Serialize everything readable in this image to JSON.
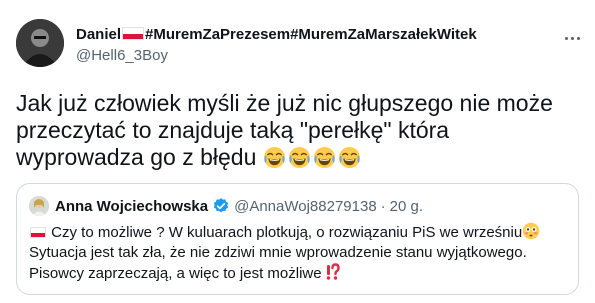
{
  "author": {
    "name_before_flag": "Daniel",
    "name_after_flag": "#MuremZaPrezesem#MuremZaMarszałekWitek",
    "handle": "@Hell6_3Boy",
    "flag_icon": "poland-flag-icon"
  },
  "tweet": {
    "text": "Jak już człowiek myśli że już nic głupszego nie może przeczytać to znajduje taką \"perełkę\" która wyprowadza go z błędu",
    "emoji": "face-with-tears-of-joy-icon",
    "emoji_count": 4
  },
  "quoted": {
    "name": "Anna Wojciechowska",
    "handle": "@AnnaWoj88279138",
    "separator": "·",
    "time": "20 g.",
    "line1": " Czy to możliwe ?  W kuluarach plotkują, o rozwiązaniu PiS  we wrześniu",
    "line2": "Sytuacja jest tak zła, że nie zdziwi mnie wprowadzenie stanu wyjątkowego.",
    "line3": "Pisowcy zaprzeczają, a więc to jest możliwe ",
    "icons": [
      "poland-flag-icon",
      "verified-badge-icon",
      "flushed-face-icon",
      "exclamation-question-icon"
    ]
  },
  "colors": {
    "text": "#0f1419",
    "secondary": "#536471",
    "verified": "#1d9bf0",
    "border": "#cfd9de",
    "flag_red": "#dc143c"
  }
}
